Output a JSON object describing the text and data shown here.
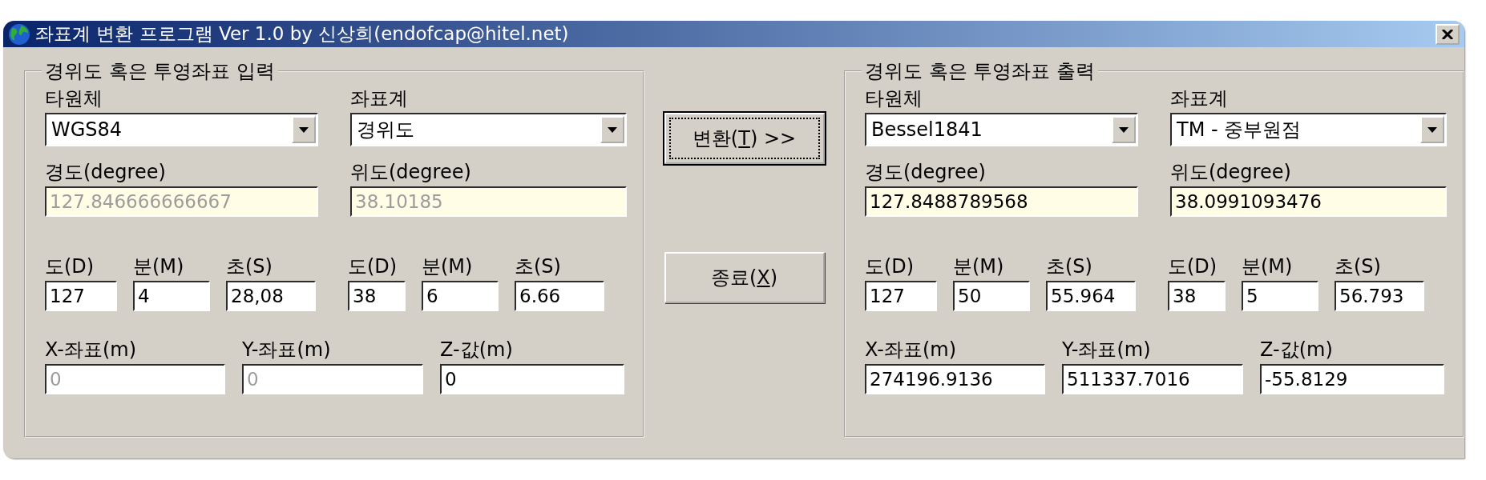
{
  "window": {
    "title": "좌표계 변환 프로그램 Ver 1.0 by 신상희(endofcap@hitel.net)"
  },
  "input_group": {
    "title": "경위도 혹은 투영좌표 입력",
    "combos": [
      {
        "label": "타원체",
        "value": "WGS84"
      },
      {
        "label": "좌표계",
        "value": "경위도"
      }
    ],
    "degrees": [
      {
        "label": "경도(degree)",
        "value": "127.846666666667",
        "disabled": true
      },
      {
        "label": "위도(degree)",
        "value": "38.10185",
        "disabled": true
      }
    ],
    "dms": [
      {
        "label": "도(D)",
        "value": "127",
        "disabled": false
      },
      {
        "label": "분(M)",
        "value": "4",
        "disabled": false
      },
      {
        "label": "초(S)",
        "value": "28,08",
        "disabled": false
      },
      {
        "label": "도(D)",
        "value": "38",
        "disabled": false
      },
      {
        "label": "분(M)",
        "value": "6",
        "disabled": false
      },
      {
        "label": "초(S)",
        "value": "6.66",
        "disabled": false
      }
    ],
    "xyz": [
      {
        "label": "X-좌표(m)",
        "value": "0",
        "disabled": true
      },
      {
        "label": "Y-좌표(m)",
        "value": "0",
        "disabled": true
      },
      {
        "label": "Z-값(m)",
        "value": "0",
        "disabled": false
      }
    ]
  },
  "buttons": [
    {
      "text": "변환(",
      "mnemonic": "T",
      "rest": ") >>",
      "focused": true
    },
    {
      "text": "종료(",
      "mnemonic": "X",
      "rest": ")",
      "focused": false
    }
  ],
  "output_group": {
    "title": "경위도 혹은 투영좌표 출력",
    "combos": [
      {
        "label": "타원체",
        "value": "Bessel1841"
      },
      {
        "label": "좌표계",
        "value": "TM - 중부원점"
      }
    ],
    "degrees": [
      {
        "label": "경도(degree)",
        "value": "127.8488789568",
        "disabled": false
      },
      {
        "label": "위도(degree)",
        "value": "38.0991093476",
        "disabled": false
      }
    ],
    "dms": [
      {
        "label": "도(D)",
        "value": "127",
        "disabled": false
      },
      {
        "label": "분(M)",
        "value": "50",
        "disabled": false
      },
      {
        "label": "초(S)",
        "value": "55.964",
        "disabled": false
      },
      {
        "label": "도(D)",
        "value": "38",
        "disabled": false
      },
      {
        "label": "분(M)",
        "value": "5",
        "disabled": false
      },
      {
        "label": "초(S)",
        "value": "56.793",
        "disabled": false
      }
    ],
    "xyz": [
      {
        "label": "X-좌표(m)",
        "value": "274196.9136",
        "disabled": false
      },
      {
        "label": "Y-좌표(m)",
        "value": "511337.7016",
        "disabled": false
      },
      {
        "label": "Z-값(m)",
        "value": "-55.8129",
        "disabled": false
      }
    ]
  }
}
